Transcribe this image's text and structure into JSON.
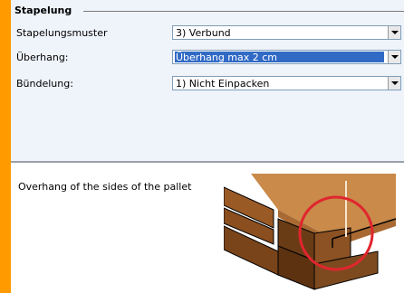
{
  "group": {
    "title": "Stapelung"
  },
  "fields": [
    {
      "label": "Stapelungsmuster",
      "value": "3) Verbund"
    },
    {
      "label": "Überhang:",
      "value": "Überhang max 2 cm"
    },
    {
      "label": "Bündelung:",
      "value": "1) Nicht Einpacken"
    }
  ],
  "info": {
    "description": "Overhang of the sides of the pallet"
  },
  "colors": {
    "accent": "#ff9a00",
    "selection": "#316ac5",
    "highlight_circle": "#e0262e"
  }
}
